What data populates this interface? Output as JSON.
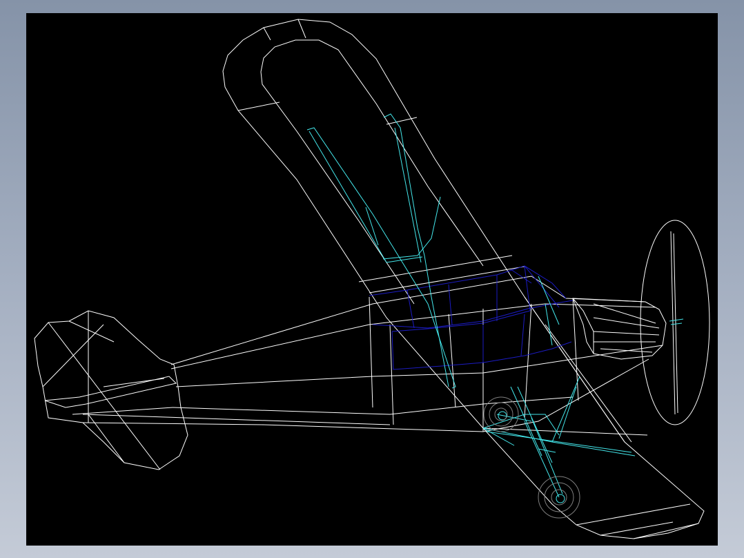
{
  "drawing": {
    "subject": "airplane-wireframe",
    "background_color": "#000000",
    "frame_gradient": [
      "#8593a8",
      "#c4cbd7"
    ],
    "colors": {
      "airframe": "#ffffff",
      "struts": "#44e8ec",
      "cabin": "#1c1cc4",
      "wheels": "#7f7f7f"
    }
  }
}
